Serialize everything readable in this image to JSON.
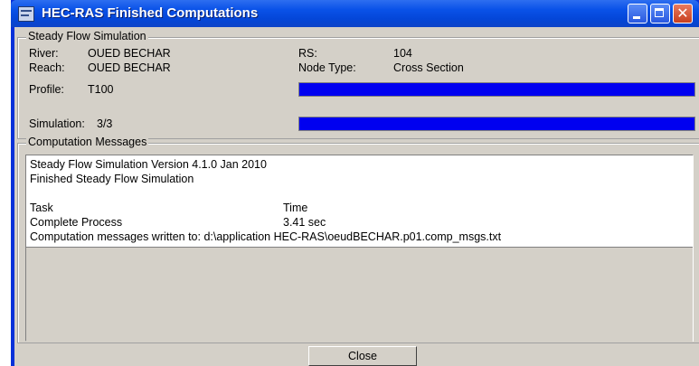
{
  "window": {
    "title": "HEC-RAS Finished Computations",
    "title_color": "#0a52e8"
  },
  "steady": {
    "legend": "Steady Flow Simulation",
    "river_label": "River:",
    "river_value": "OUED BECHAR",
    "reach_label": "Reach:",
    "reach_value": "OUED BECHAR",
    "profile_label": "Profile:",
    "profile_value": "T100",
    "rs_label": "RS:",
    "rs_value": "104",
    "node_type_label": "Node Type:",
    "node_type_value": "Cross Section",
    "simulation_label": "Simulation:",
    "simulation_value": "3/3",
    "profile_progress": 1.0,
    "simulation_progress": 1.0,
    "progress_color": "#0000f0"
  },
  "messages": {
    "legend": "Computation Messages",
    "lines": [
      "Steady Flow Simulation Version 4.1.0 Jan 2010",
      "Finished Steady Flow Simulation",
      "",
      "Task",
      "Complete Process",
      "Computation messages written to: d:\\application HEC-RAS\\oeudBECHAR.p01.comp_msgs.txt"
    ],
    "time_header": "Time",
    "time_value": "3.41 sec"
  },
  "buttons": {
    "close_label": "Close"
  },
  "icons": {
    "app": "hec-ras-app-icon",
    "minimize": "minimize-icon",
    "maximize": "maximize-icon",
    "close": "close-icon"
  }
}
